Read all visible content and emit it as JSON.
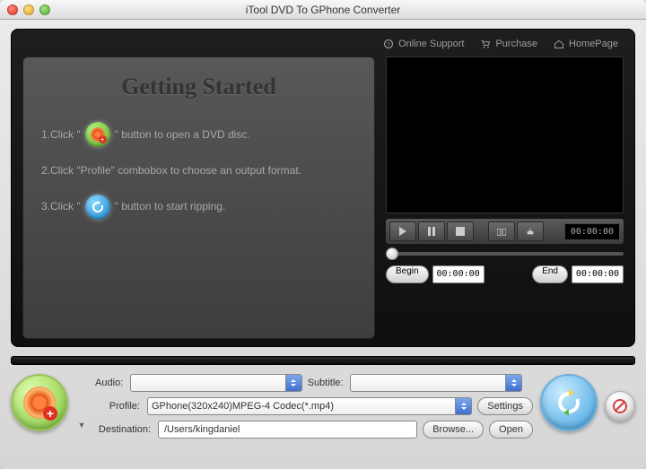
{
  "window": {
    "title": "iTool DVD To GPhone Converter"
  },
  "toplinks": {
    "support": "Online Support",
    "purchase": "Purchase",
    "homepage": "HomePage"
  },
  "getting": {
    "heading": "Getting Started",
    "step1a": "1.Click \"",
    "step1b": "\" button to open a DVD disc.",
    "step2": "2.Click \"Profile\" combobox to choose an output format.",
    "step3a": "3.Click \"",
    "step3b": "\" button to start ripping."
  },
  "player": {
    "time": "00:00:00"
  },
  "trim": {
    "begin_label": "Begin",
    "begin_time": "00:00:00",
    "end_label": "End",
    "end_time": "00:00:00"
  },
  "fields": {
    "audio_label": "Audio:",
    "audio_value": "",
    "subtitle_label": "Subtitle:",
    "subtitle_value": "",
    "profile_label": "Profile:",
    "profile_value": "GPhone(320x240)MPEG-4 Codec(*.mp4)",
    "settings_label": "Settings",
    "destination_label": "Destination:",
    "destination_value": "/Users/kingdaniel",
    "browse_label": "Browse...",
    "open_label": "Open"
  }
}
